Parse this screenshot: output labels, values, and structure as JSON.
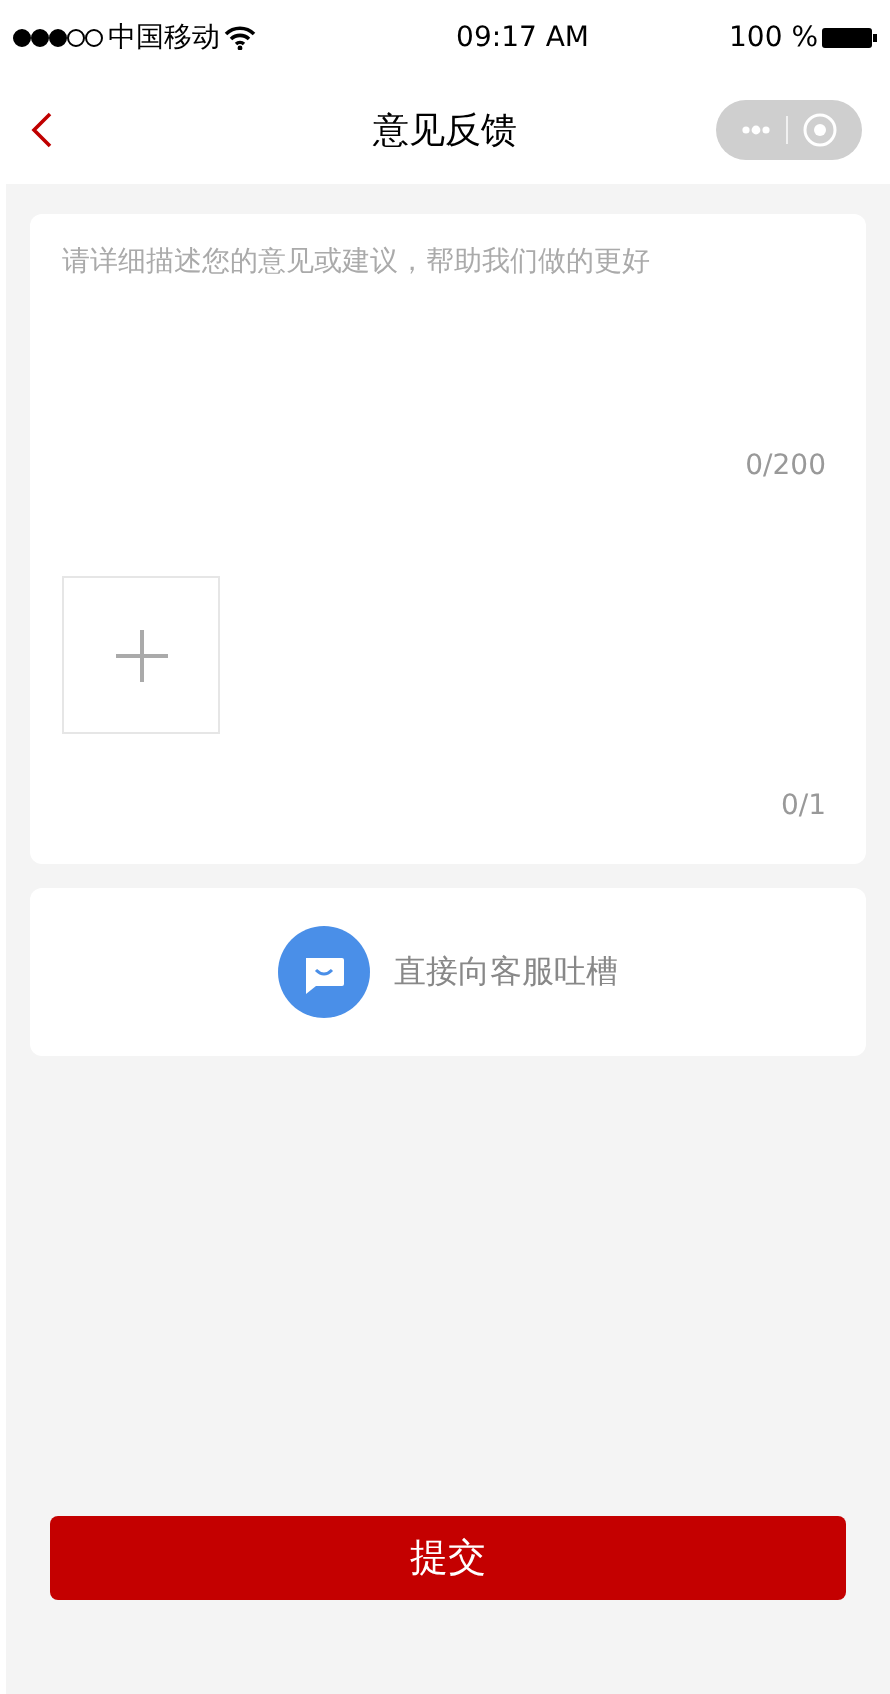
{
  "status_bar": {
    "carrier": "中国移动",
    "time": "09:17 AM",
    "battery": "100 %"
  },
  "nav": {
    "title": "意见反馈"
  },
  "feedback": {
    "placeholder": "请详细描述您的意见或建议，帮助我们做的更好",
    "char_count": "0/200",
    "image_count": "0/1"
  },
  "service": {
    "label": "直接向客服吐槽"
  },
  "submit": "提交"
}
